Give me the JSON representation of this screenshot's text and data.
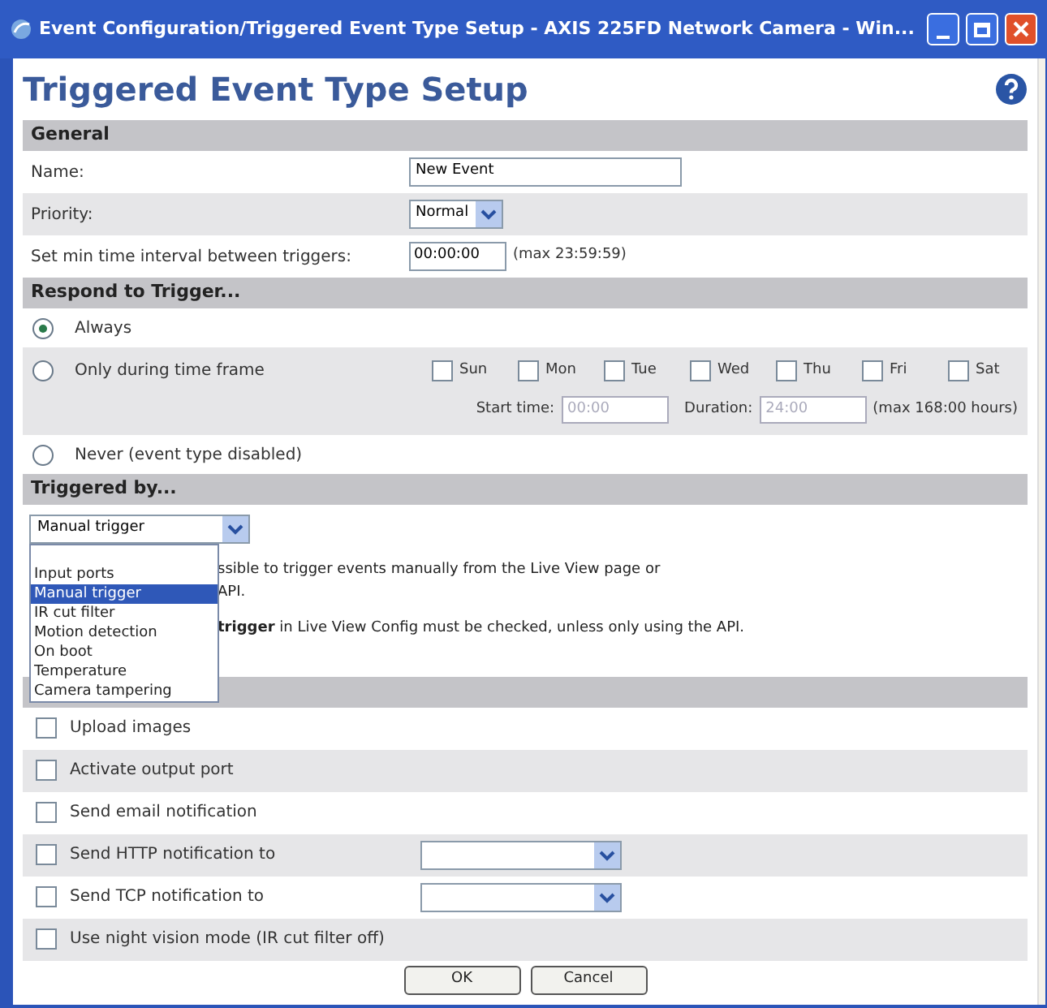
{
  "window": {
    "title": "Event Configuration/Triggered Event Type Setup - AXIS 225FD Network Camera - Win..."
  },
  "page_title": "Triggered Event Type Setup",
  "general": {
    "header": "General",
    "fields": [
      {
        "kind": "text",
        "label": "Name:",
        "value": "New Event"
      },
      {
        "kind": "select",
        "label": "Priority:",
        "value": "Normal"
      },
      {
        "kind": "time",
        "label": "Set min time interval between triggers:",
        "value": "00:00:00",
        "note": "(max 23:59:59)"
      }
    ]
  },
  "respond": {
    "header": "Respond to Trigger...",
    "options": [
      {
        "kind": "plain",
        "label": "Always",
        "selected": true
      },
      {
        "kind": "timeframe",
        "label": "Only during time frame",
        "selected": false
      },
      {
        "kind": "plain",
        "label": "Never (event type disabled)",
        "selected": false
      }
    ],
    "days": [
      {
        "label": "Sun",
        "checked": false
      },
      {
        "label": "Mon",
        "checked": false
      },
      {
        "label": "Tue",
        "checked": false
      },
      {
        "label": "Wed",
        "checked": false
      },
      {
        "label": "Thu",
        "checked": false
      },
      {
        "label": "Fri",
        "checked": false
      },
      {
        "label": "Sat",
        "checked": false
      }
    ],
    "start_label": "Start time:",
    "start_value": "00:00",
    "duration_label": "Duration:",
    "duration_value": "24:00",
    "duration_note": "(max 168:00 hours)"
  },
  "triggered": {
    "header": "Triggered by...",
    "value": "Manual trigger",
    "options": [
      {
        "label": "Input ports",
        "selected": false
      },
      {
        "label": "Manual trigger",
        "selected": true
      },
      {
        "label": "IR cut filter",
        "selected": false
      },
      {
        "label": "Motion detection",
        "selected": false
      },
      {
        "label": "On boot",
        "selected": false
      },
      {
        "label": "Temperature",
        "selected": false
      },
      {
        "label": "Camera tampering",
        "selected": false
      }
    ],
    "description": [
      "ssible to trigger events manually from the Live View page or",
      "API.",
      "**trigger** in Live View Config must be checked, unless only using the API."
    ]
  },
  "actions": [
    {
      "kind": "plain",
      "label": "Upload images",
      "checked": false
    },
    {
      "kind": "plain",
      "label": "Activate output port",
      "checked": false
    },
    {
      "kind": "plain",
      "label": "Send email notification",
      "checked": false
    },
    {
      "kind": "select",
      "label": "Send HTTP notification to",
      "checked": false
    },
    {
      "kind": "select",
      "label": "Send TCP notification to",
      "checked": false
    },
    {
      "kind": "plain",
      "label": "Use night vision mode (IR cut filter off)",
      "checked": false
    }
  ],
  "buttons": [
    "OK",
    "Cancel"
  ]
}
